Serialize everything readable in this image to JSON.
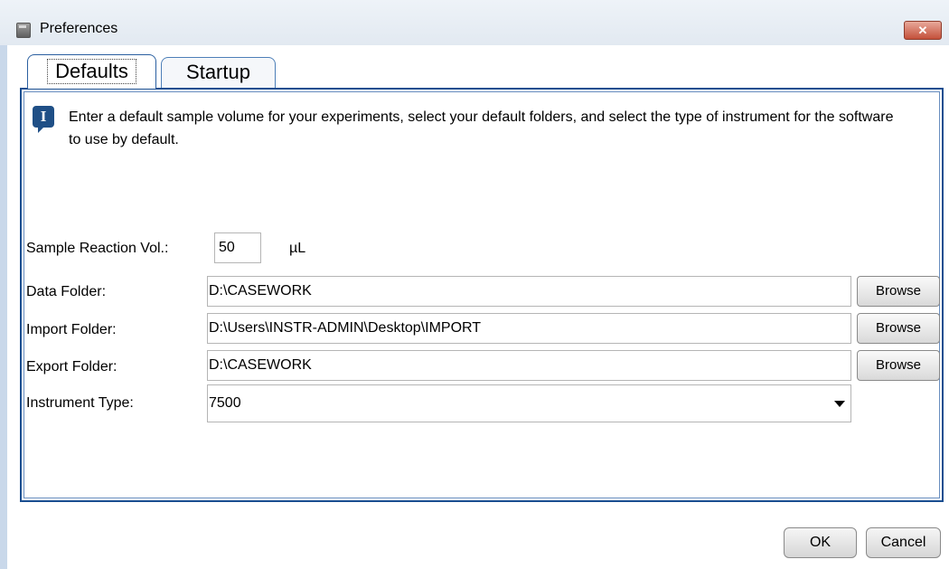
{
  "window": {
    "title": "Preferences",
    "close_symbol": "✕",
    "close_color": "#c4503a"
  },
  "tabs": [
    {
      "label": "Defaults",
      "selected": true
    },
    {
      "label": "Startup",
      "selected": false
    }
  ],
  "info": {
    "icon": "info-icon",
    "icon_glyph": "I",
    "text": "Enter a default sample volume for your experiments, select your default folders, and select the type of instrument for the software to use by default."
  },
  "form": {
    "sample_volume": {
      "label": "Sample Reaction Vol.:",
      "value": "50",
      "unit": "µL"
    },
    "data_folder": {
      "label": "Data Folder:",
      "value": "D:\\CASEWORK",
      "button": "Browse"
    },
    "import_folder": {
      "label": "Import Folder:",
      "value": "D:\\Users\\INSTR-ADMIN\\Desktop\\IMPORT",
      "button": "Browse"
    },
    "export_folder": {
      "label": "Export Folder:",
      "value": "D:\\CASEWORK",
      "button": "Browse"
    },
    "instrument_type": {
      "label": "Instrument Type:",
      "value": "7500"
    }
  },
  "buttons": {
    "ok": "OK",
    "cancel": "Cancel"
  },
  "colors": {
    "panel_border": "#1a4e90",
    "tab_border": "#4d7fb8"
  }
}
